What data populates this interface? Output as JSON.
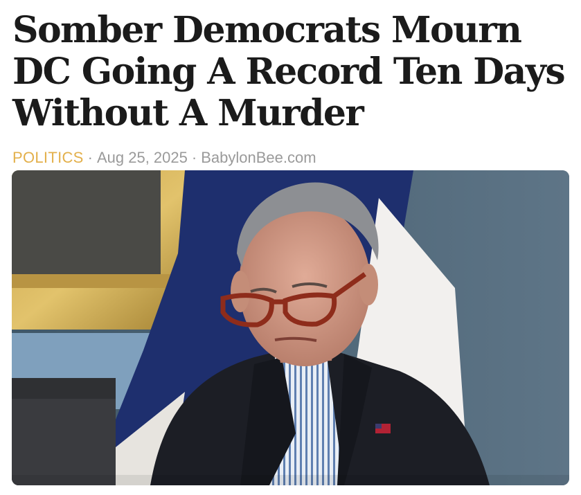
{
  "article": {
    "headline": "Somber Democrats Mourn DC Going A Record Ten Days Without A Murder",
    "category": "POLITICS",
    "separator": "·",
    "date": "Aug 25, 2025",
    "source": "BabylonBee.com"
  },
  "colors": {
    "category": "#e3b04b",
    "meta_text": "#9a9a9a",
    "headline": "#1b1b1b"
  }
}
